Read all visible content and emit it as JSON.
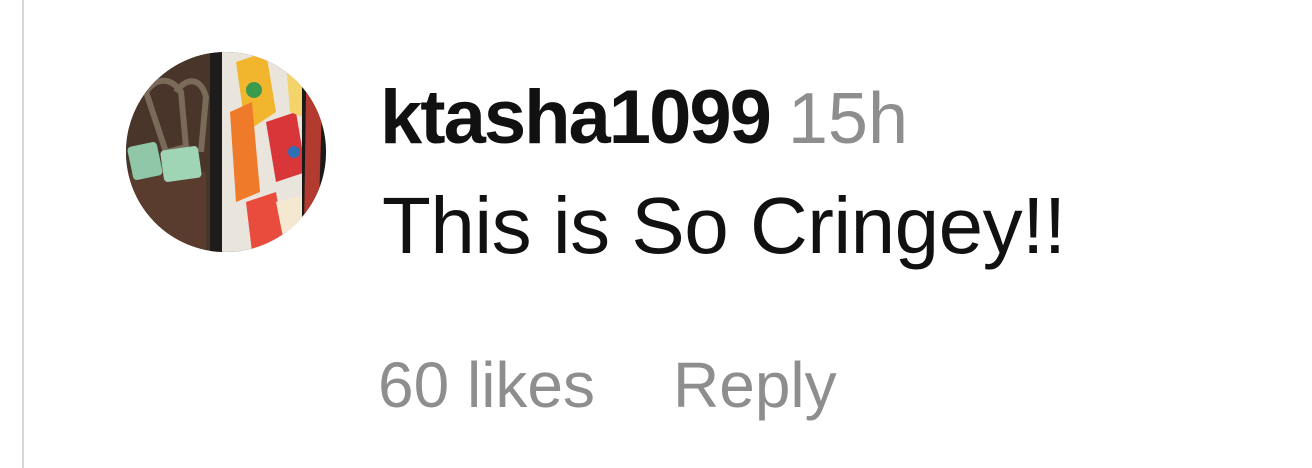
{
  "comment": {
    "username": "ktasha1099",
    "timestamp": "15h",
    "text": "This is So Cringey!!",
    "likes_label": "60 likes",
    "reply_label": "Reply"
  },
  "avatar": {
    "icon": "user-avatar-photo"
  },
  "colors": {
    "username": "#111111",
    "meta": "#8e8e8e",
    "background": "#ffffff"
  }
}
